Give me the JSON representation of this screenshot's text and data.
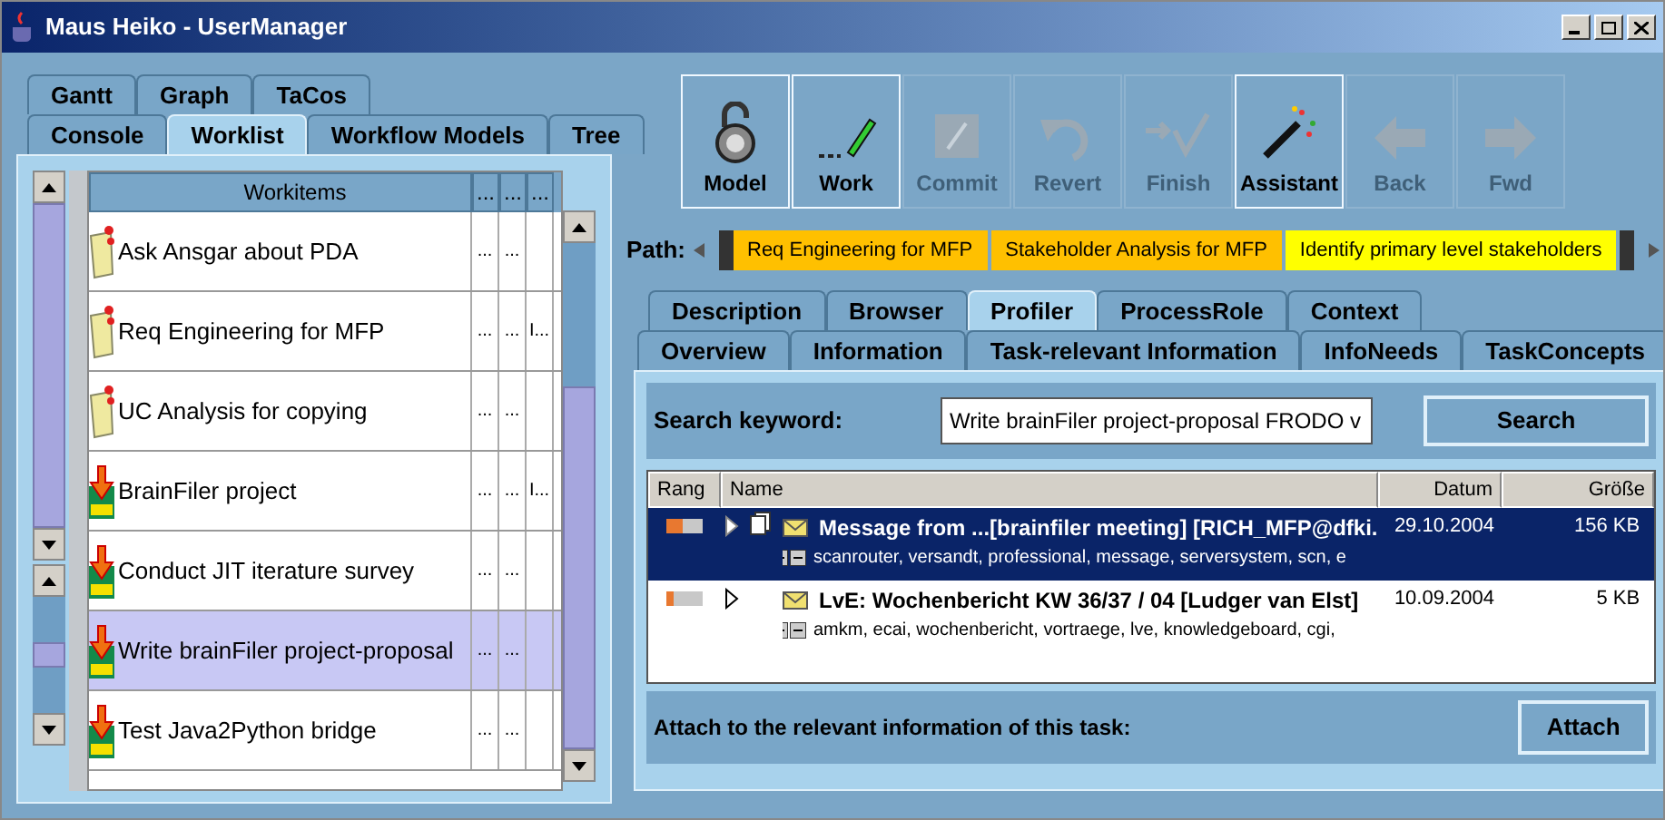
{
  "window": {
    "title": "Maus Heiko - UserManager"
  },
  "left_tabs": [
    [
      {
        "label": "Gantt",
        "selected": false
      },
      {
        "label": "Graph",
        "selected": false
      },
      {
        "label": "TaCos",
        "selected": false
      }
    ],
    [
      {
        "label": "Console",
        "selected": false
      },
      {
        "label": "Worklist",
        "selected": true
      },
      {
        "label": "Workflow Models",
        "selected": false
      },
      {
        "label": "Tree",
        "selected": false
      }
    ]
  ],
  "worklist": {
    "columns": [
      "Workitems",
      "...",
      "...",
      "..."
    ],
    "rows": [
      {
        "kind": "todo",
        "cells": [
          "Ask Ansgar about PDA",
          "...",
          "..."
        ],
        "selected": false
      },
      {
        "kind": "todo",
        "cells": [
          "Req Engineering for MFP",
          "...",
          "...",
          "I..."
        ],
        "selected": false
      },
      {
        "kind": "todo",
        "cells": [
          "UC Analysis for copying",
          "...",
          "..."
        ],
        "selected": false
      },
      {
        "kind": "download",
        "cells": [
          "BrainFiler project",
          "...",
          "...",
          "I..."
        ],
        "selected": false
      },
      {
        "kind": "download",
        "cells": [
          "Conduct JIT iterature survey",
          "...",
          "..."
        ],
        "selected": false
      },
      {
        "kind": "download",
        "cells": [
          "Write brainFiler project-proposal",
          "...",
          "..."
        ],
        "selected": true
      },
      {
        "kind": "download",
        "cells": [
          "Test Java2Python bridge",
          "...",
          "..."
        ],
        "selected": false
      }
    ]
  },
  "toolbar": [
    {
      "kind": "lock",
      "label": "Model",
      "disabled": false
    },
    {
      "kind": "pen",
      "label": "Work",
      "disabled": false
    },
    {
      "kind": "commit",
      "label": "Commit",
      "disabled": true
    },
    {
      "kind": "revert",
      "label": "Revert",
      "disabled": true
    },
    {
      "kind": "finish",
      "label": "Finish",
      "disabled": true
    },
    {
      "kind": "wand",
      "label": "Assistant",
      "disabled": false
    },
    {
      "kind": "back",
      "label": "Back",
      "disabled": true
    },
    {
      "kind": "forward",
      "label": "Fwd",
      "disabled": true
    }
  ],
  "path": {
    "label": "Path:",
    "items": [
      {
        "label": "Req Engineering for MFP",
        "color": "#ffc000"
      },
      {
        "label": "Stakeholder Analysis for MFP",
        "color": "#ffc000"
      },
      {
        "label": "Identify primary level stakeholders",
        "color": "#ffff00"
      }
    ]
  },
  "right_tabs": [
    [
      {
        "label": "Description",
        "selected": false
      },
      {
        "label": "Browser",
        "selected": false
      },
      {
        "label": "Profiler",
        "selected": true
      },
      {
        "label": "ProcessRole",
        "selected": false
      },
      {
        "label": "Context",
        "selected": false
      }
    ],
    [
      {
        "label": "Overview",
        "selected": false
      },
      {
        "label": "Information",
        "selected": false
      },
      {
        "label": "Task-relevant Information",
        "selected": false
      },
      {
        "label": "InfoNeeds",
        "selected": false
      },
      {
        "label": "TaskConcepts",
        "selected": false
      }
    ]
  ],
  "search": {
    "label": "Search keyword:",
    "value": "Write brainFiler project-proposal FRODO v",
    "button": "Search"
  },
  "results": {
    "columns": [
      "Rang",
      "Name",
      "Datum",
      "Größe"
    ],
    "rows": [
      {
        "level": 0.45,
        "attachment": true,
        "title": "Message from ...[brainfiler meeting] [RICH_MFP@dfki.",
        "keywords": "scanrouter, versandt, professional, message, serversystem, scn, e",
        "date": "29.10.2004",
        "size": "156 KB",
        "selected": true
      },
      {
        "level": 0.2,
        "attachment": false,
        "title": "LvE: Wochenbericht KW 36/37 / 04 [Ludger van Elst]",
        "keywords": "amkm, ecai, wochenbericht, vortraege, lve, knowledgeboard, cgi,",
        "date": "10.09.2004",
        "size": "5 KB",
        "selected": false
      }
    ]
  },
  "attach": {
    "label": "Attach to the relevant information of this task:",
    "button": "Attach"
  }
}
